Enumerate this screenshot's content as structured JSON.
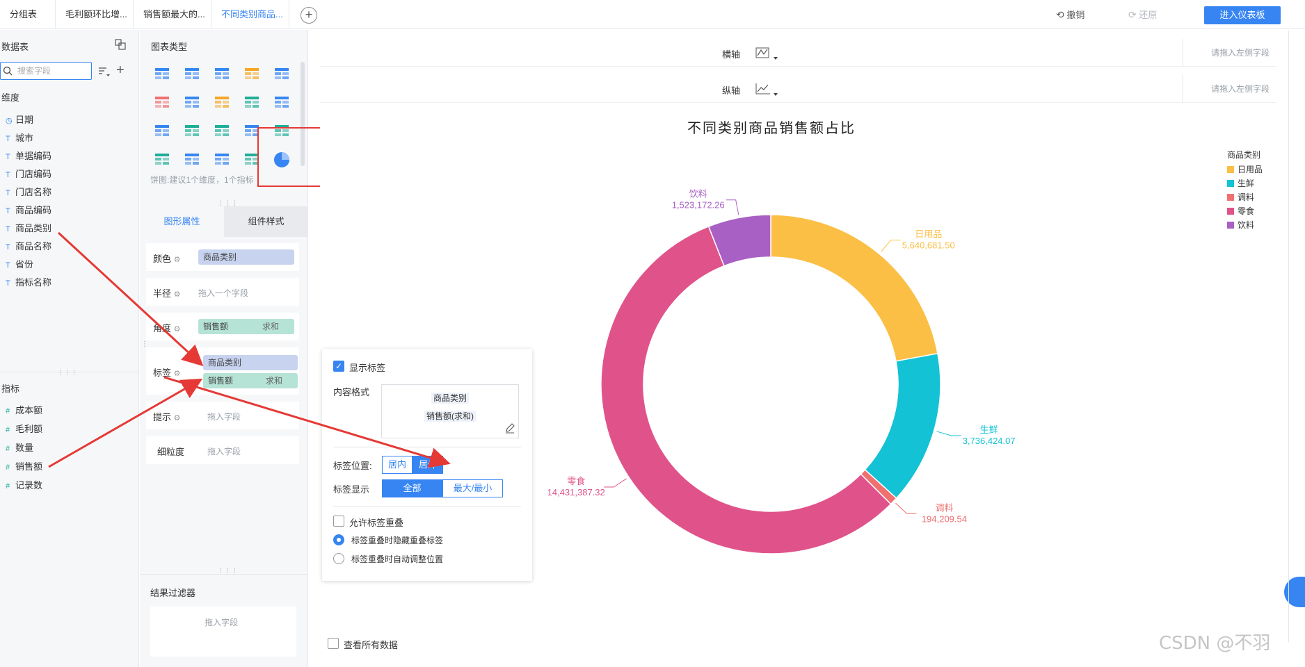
{
  "tabs": [
    {
      "label": "分组表",
      "active": false
    },
    {
      "label": "毛利额环比增...",
      "active": false
    },
    {
      "label": "销售额最大的...",
      "active": false
    },
    {
      "label": "不同类别商品...",
      "active": true
    }
  ],
  "toolbar": {
    "undo_label": "撤销",
    "redo_label": "还原",
    "enter_dashboard_label": "进入仪表板"
  },
  "data_panel": {
    "title": "数据表",
    "search_placeholder": "搜索字段",
    "dimension_title": "维度",
    "dimensions": [
      "日期",
      "城市",
      "单据编码",
      "门店编码",
      "门店名称",
      "商品编码",
      "商品类别",
      "商品名称",
      "省份",
      "指标名称"
    ],
    "measure_title": "指标",
    "measures": [
      "成本额",
      "毛利额",
      "数量",
      "销售额",
      "记录数"
    ]
  },
  "chart_config": {
    "chart_type_title": "图表类型",
    "chart_type_hint": "饼图:建议1个维度，1个指标",
    "tab_properties": "图形属性",
    "tab_styles": "组件样式",
    "color_label": "颜色",
    "color_field": "商品类别",
    "radius_label": "半径",
    "radius_placeholder": "拖入一个字段",
    "angle_label": "角度",
    "angle_field": "销售额",
    "angle_agg": "求和",
    "label_label": "标签",
    "label_field_1": "商品类别",
    "label_field_2": "销售额",
    "label_field_2_agg": "求和",
    "tooltip_label": "提示",
    "tooltip_placeholder": "拖入字段",
    "granularity_label": "细粒度",
    "granularity_placeholder": "拖入字段",
    "result_filter_title": "结果过滤器",
    "result_filter_placeholder": "拖入字段"
  },
  "axes": {
    "x_label": "横轴",
    "y_label": "纵轴",
    "drop_placeholder": "请拖入左侧字段"
  },
  "label_popup": {
    "show_label": "显示标签",
    "content_format_label": "内容格式",
    "content_line_1": "商品类别",
    "content_line_2": "销售额(求和)",
    "position_label": "标签位置:",
    "position_inside": "居内",
    "position_outside": "居外",
    "display_label": "标签显示",
    "display_all": "全部",
    "display_maxmin": "最大/最小",
    "allow_overlap": "允许标签重叠",
    "overlap_hide": "标签重叠时隐藏重叠标签",
    "overlap_adjust": "标签重叠时自动调整位置"
  },
  "view_all_data": "查看所有数据",
  "watermark": "CSDN @不羽",
  "colors": {
    "accent": "#3685f2",
    "annotation_red": "#e53935"
  },
  "chart_data": {
    "type": "pie",
    "title": "不同类别商品销售额占比",
    "legend_title": "商品类别",
    "legend_position": "top-right",
    "donut": true,
    "categories": [
      "日用品",
      "生鲜",
      "调料",
      "零食",
      "饮料"
    ],
    "values": [
      5640681.5,
      3736424.07,
      194209.54,
      14431387.32,
      1523172.26
    ],
    "value_labels": [
      "5,640,681.50",
      "3,736,424.07",
      "194,209.54",
      "14,431,387.32",
      "1,523,172.26"
    ],
    "colors": [
      "#fbbf45",
      "#13c2d4",
      "#f07070",
      "#e0538a",
      "#a860c4"
    ]
  }
}
